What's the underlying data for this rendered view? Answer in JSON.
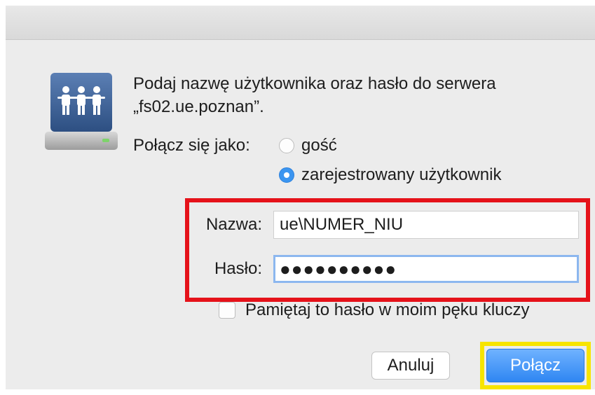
{
  "dialog": {
    "message_line1": "Podaj nazwę użytkownika oraz hasło do serwera",
    "message_line2": "„fs02.ue.poznan”.",
    "connect_as_label": "Połącz się jako:",
    "radio_guest": "gość",
    "radio_registered": "zarejestrowany użytkownik",
    "selected_radio": "registered",
    "name_label": "Nazwa:",
    "name_value": "ue\\NUMER_NIU",
    "password_label": "Hasło:",
    "password_value": "●●●●●●●●●●",
    "remember_label": "Pamiętaj to hasło w moim pęku kluczy",
    "remember_checked": false,
    "cancel_button": "Anuluj",
    "connect_button": "Połącz"
  },
  "icons": {
    "server": "network-server-users-icon"
  },
  "colors": {
    "accent": "#3b95f0",
    "highlight_red": "#e5121a",
    "highlight_yellow": "#f7e400",
    "focus_ring": "#8cb7ef"
  }
}
